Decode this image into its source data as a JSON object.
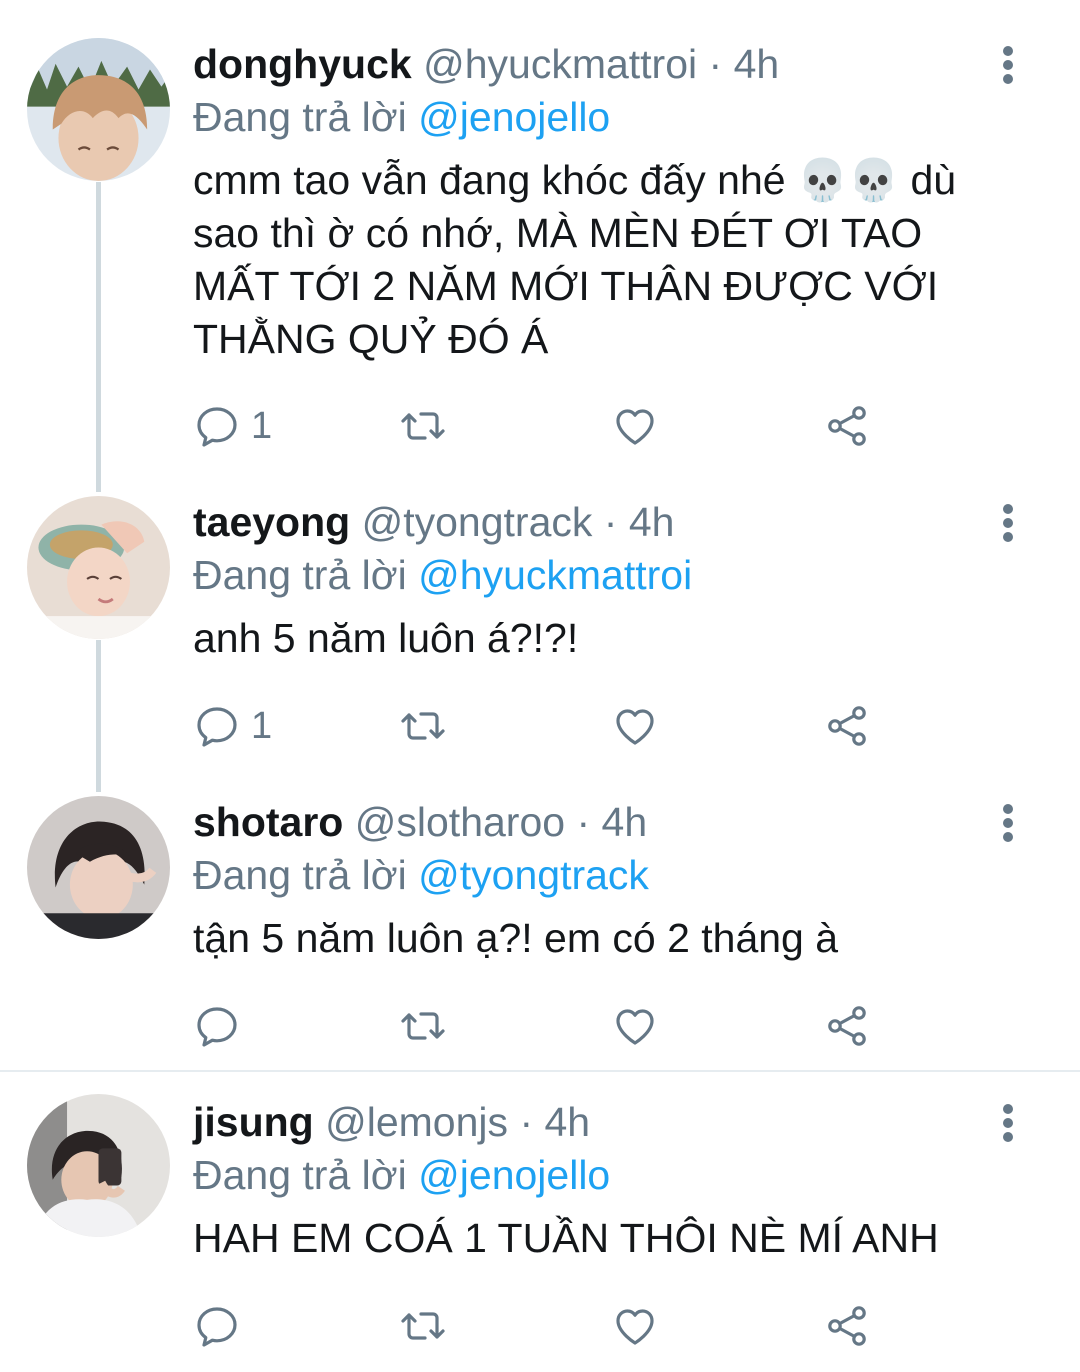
{
  "colors": {
    "text": "#14171a",
    "secondary": "#657786",
    "mention": "#1da1f2",
    "thread_line": "#cfd9de",
    "divider": "#e6ecf0"
  },
  "replying_label": "Đang trả lời",
  "separator": "·",
  "tweets": [
    {
      "display_name": "donghyuck",
      "handle": "@hyuckmattroi",
      "time": "4h",
      "reply_to": "@jenojello",
      "text": "cmm tao vẫn đang khóc đấy nhé 💀💀 dù sao thì ờ có nhớ, MÀ MÈN ĐÉT ƠI TAO MẤT TỚI 2 NĂM MỚI THÂN ĐƯỢC VỚI THẰNG QUỶ ĐÓ Á",
      "reply_count": "1",
      "icons": [
        "reply-icon",
        "retweet-icon",
        "like-icon",
        "share-icon",
        "more-icon"
      ]
    },
    {
      "display_name": "taeyong",
      "handle": "@tyongtrack",
      "time": "4h",
      "reply_to": "@hyuckmattroi",
      "text": "anh 5 năm luôn á?!?!",
      "reply_count": "1",
      "icons": [
        "reply-icon",
        "retweet-icon",
        "like-icon",
        "share-icon",
        "more-icon"
      ]
    },
    {
      "display_name": "shotaro",
      "handle": "@slotharoo",
      "time": "4h",
      "reply_to": "@tyongtrack",
      "text": "tận 5 năm luôn ạ?! em có 2 tháng à",
      "reply_count": "",
      "icons": [
        "reply-icon",
        "retweet-icon",
        "like-icon",
        "share-icon",
        "more-icon"
      ]
    },
    {
      "display_name": "jisung",
      "handle": "@lemonjs",
      "time": "4h",
      "reply_to": "@jenojello",
      "text": "HAH EM COÁ 1 TUẦN THÔI NÈ MÍ ANH",
      "reply_count": "",
      "icons": [
        "reply-icon",
        "retweet-icon",
        "like-icon",
        "share-icon",
        "more-icon"
      ]
    }
  ]
}
